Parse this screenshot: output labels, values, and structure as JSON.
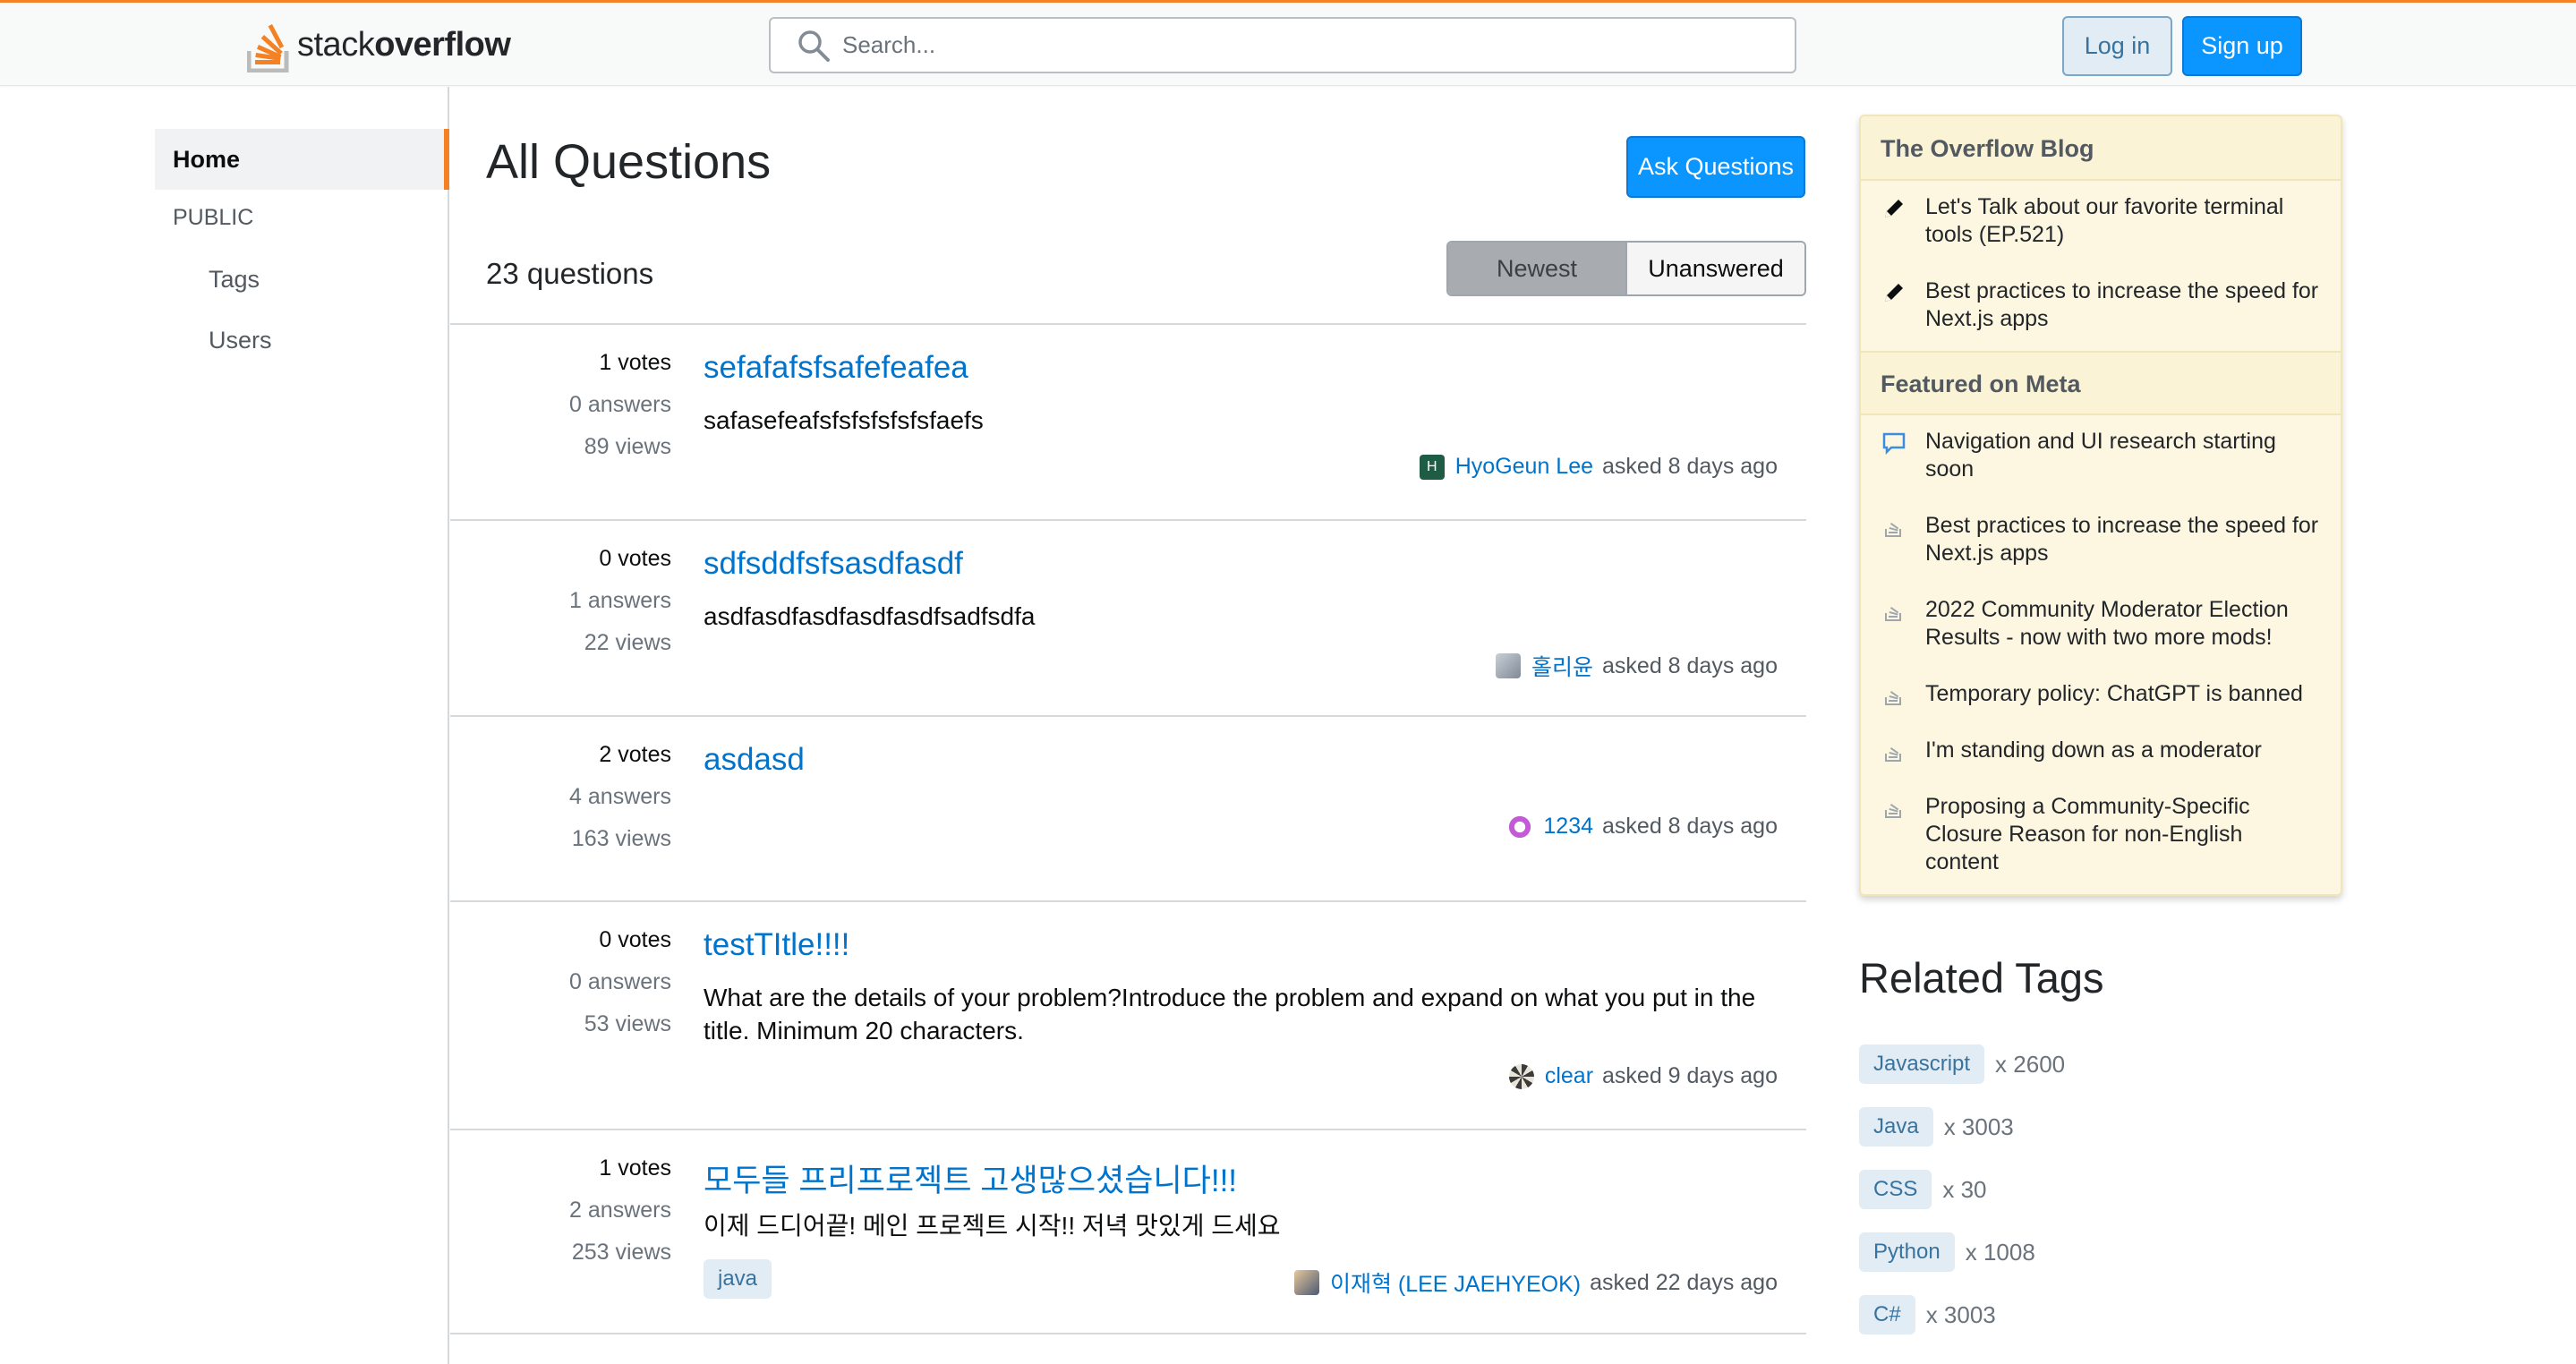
{
  "header": {
    "logo_light": "stack",
    "logo_bold": "overflow",
    "search_placeholder": "Search...",
    "login_label": "Log in",
    "signup_label": "Sign up"
  },
  "sidebar": {
    "home": "Home",
    "public": "PUBLIC",
    "tags": "Tags",
    "users": "Users"
  },
  "main": {
    "title": "All Questions",
    "ask_button": "Ask Questions",
    "count": "23 questions",
    "filters": [
      "Newest",
      "Unanswered"
    ],
    "questions": [
      {
        "votes": "1 votes",
        "answers": "0 answers",
        "views": "89 views",
        "title": "sefafafsfsafefeafea",
        "body": "safasefeafsfsfsfsfsfsfaefs",
        "user": "HyoGeun Lee",
        "avatar_letter": "H",
        "asked": "asked 8 days ago",
        "tags": []
      },
      {
        "votes": "0 votes",
        "answers": "1 answers",
        "views": "22 views",
        "title": "sdfsddfsfsasdfasdf",
        "body": "asdfasdfasdfasdfasdfsadfsdfa",
        "user": "홀리윤",
        "asked": "asked 8 days ago",
        "tags": []
      },
      {
        "votes": "2 votes",
        "answers": "4 answers",
        "views": "163 views",
        "title": "asdasd",
        "body": "",
        "user": "1234",
        "asked": "asked 8 days ago",
        "tags": []
      },
      {
        "votes": "0 votes",
        "answers": "0 answers",
        "views": "53 views",
        "title": "testTItle!!!!",
        "body": "What are the details of your problem?Introduce the problem and expand on what you put in the title. Minimum 20 characters.",
        "user": "clear",
        "asked": "asked 9 days ago",
        "tags": []
      },
      {
        "votes": "1 votes",
        "answers": "2 answers",
        "views": "253 views",
        "title": "모두들 프리프로젝트 고생많으셨습니다!!!",
        "body": "이제 드디어끝! 메인 프로젝트 시작!! 저녁 맛있게 드세요",
        "user": "이재혁 (LEE JAEHYEOK)",
        "asked": "asked 22 days ago",
        "tags": [
          "java"
        ]
      }
    ]
  },
  "blog": {
    "title": "The Overflow Blog",
    "items": [
      "Let's Talk about our favorite terminal tools (EP.521)",
      "Best practices to increase the speed for Next.js apps"
    ],
    "meta_title": "Featured on Meta",
    "meta_items": [
      "Navigation and UI research starting soon",
      "Best practices to increase the speed for Next.js apps",
      "2022 Community Moderator Election Results - now with two more mods!",
      "Temporary policy: ChatGPT is banned",
      "I'm standing down as a moderator",
      "Proposing a Community-Specific Closure Reason for non-English content"
    ]
  },
  "related": {
    "title": "Related Tags",
    "tags": [
      {
        "name": "Javascript",
        "count": "x 2600"
      },
      {
        "name": "Java",
        "count": "x 3003"
      },
      {
        "name": "CSS",
        "count": "x 30"
      },
      {
        "name": "Python",
        "count": "x 1008"
      },
      {
        "name": "C#",
        "count": "x 3003"
      }
    ]
  },
  "colors": {
    "accent": "#f48225",
    "link": "#0074cc",
    "primary_button": "#0a95ff",
    "blog_bg": "#fdf7e2"
  }
}
